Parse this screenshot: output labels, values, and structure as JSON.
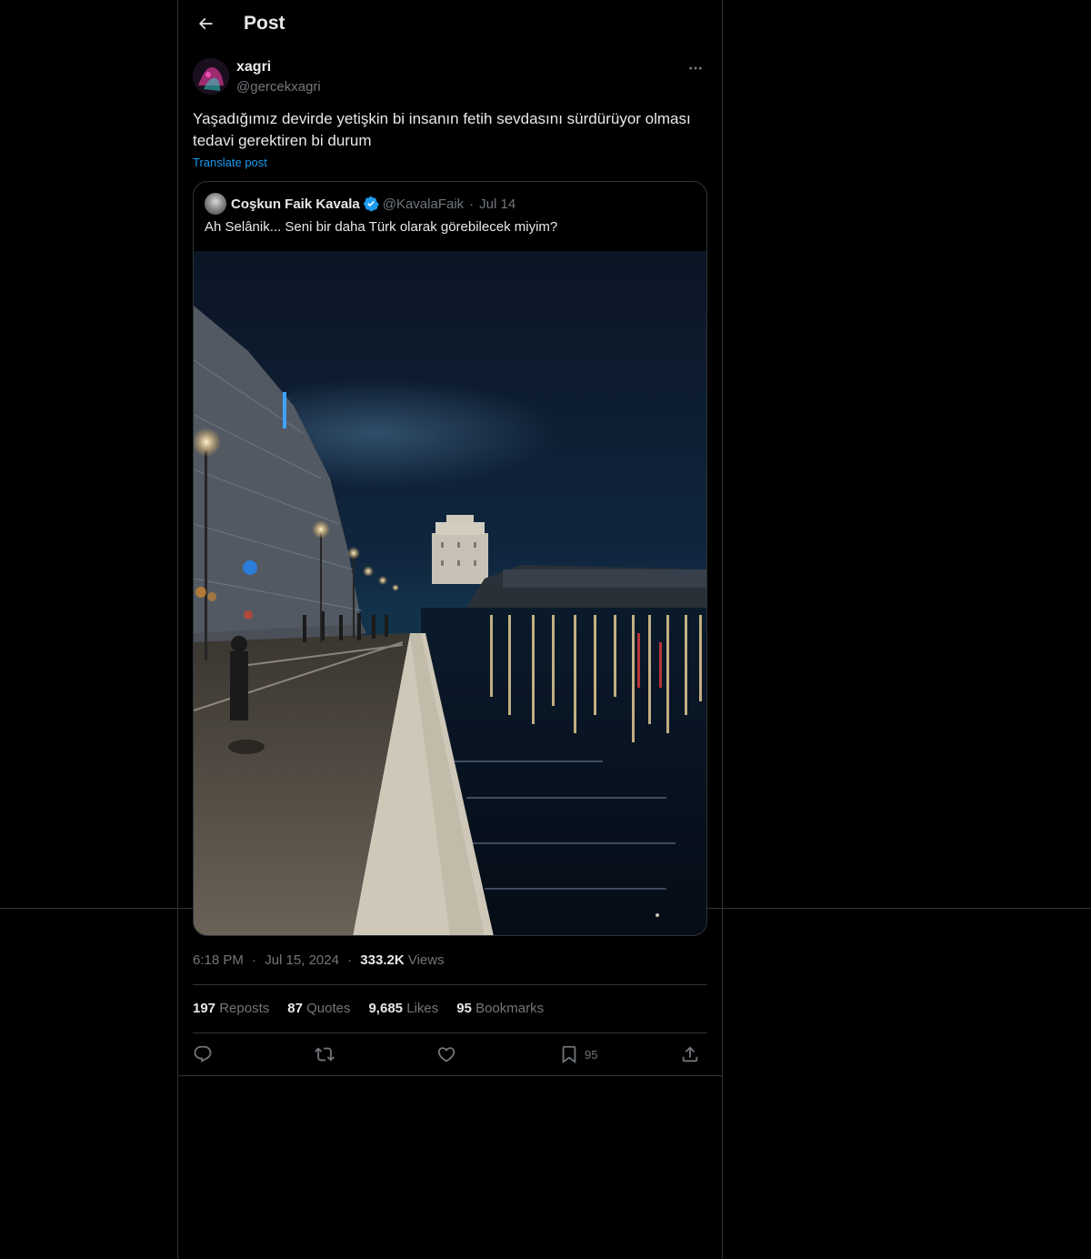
{
  "header": {
    "title": "Post",
    "back_icon": "arrow-left-icon"
  },
  "post": {
    "author_name": "xagri",
    "author_handle": "@gercekxagri",
    "more_icon": "ellipsis-icon",
    "text": "Yaşadığımız devirde yetişkin bi insanın fetih sevdasını sürdürüyor olması tedavi gerektiren bi durum",
    "translate_label": "Translate post",
    "time": "6:18 PM",
    "date": "Jul 15, 2024",
    "views_count": "333.2K",
    "views_label": "Views",
    "dot": "·"
  },
  "quote": {
    "author_name": "Coşkun Faik Kavala",
    "verified_icon": "verified-badge-icon",
    "author_handle": "@KavalaFaik",
    "dot": "·",
    "date": "Jul 14",
    "text": "Ah Selânik... Seni bir daha Türk olarak görebilecek miyim?",
    "media": "night-waterfront-photo"
  },
  "stats": [
    {
      "count": "197",
      "label": "Reposts"
    },
    {
      "count": "87",
      "label": "Quotes"
    },
    {
      "count": "9,685",
      "label": "Likes"
    },
    {
      "count": "95",
      "label": "Bookmarks"
    }
  ],
  "actions": {
    "reply_icon": "reply-icon",
    "repost_icon": "repost-icon",
    "like_icon": "heart-icon",
    "bookmark_icon": "bookmark-icon",
    "bookmark_count": "95",
    "share_icon": "share-icon"
  },
  "colors": {
    "background": "#000000",
    "text": "#e7e9ea",
    "muted": "#71767b",
    "border": "#2f3336",
    "accent": "#1d9bf0"
  }
}
